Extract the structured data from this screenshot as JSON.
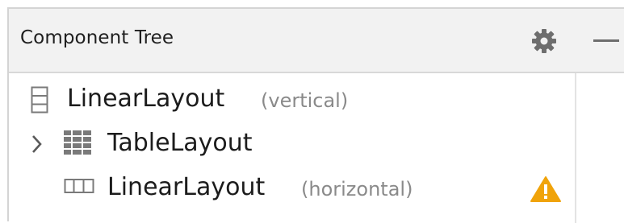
{
  "panel": {
    "title": "Component Tree"
  },
  "icons": {
    "settings": "gear-icon",
    "minimize": "minimize-icon",
    "expand": "chevron-right-icon",
    "vertical_layout": "linear-layout-vertical-icon",
    "table_layout": "table-layout-icon",
    "horizontal_layout": "linear-layout-horizontal-icon",
    "warning": "warning-icon"
  },
  "colors": {
    "header_bg": "#f2f2f2",
    "icon_gray": "#7a7a7a",
    "warning": "#f0a30a"
  },
  "tree": [
    {
      "label": "LinearLayout",
      "hint": "(vertical)",
      "expandable": false,
      "warning": false
    },
    {
      "label": "TableLayout",
      "hint": "",
      "expandable": true,
      "warning": false
    },
    {
      "label": "LinearLayout",
      "hint": "(horizontal)",
      "expandable": false,
      "warning": true
    }
  ]
}
